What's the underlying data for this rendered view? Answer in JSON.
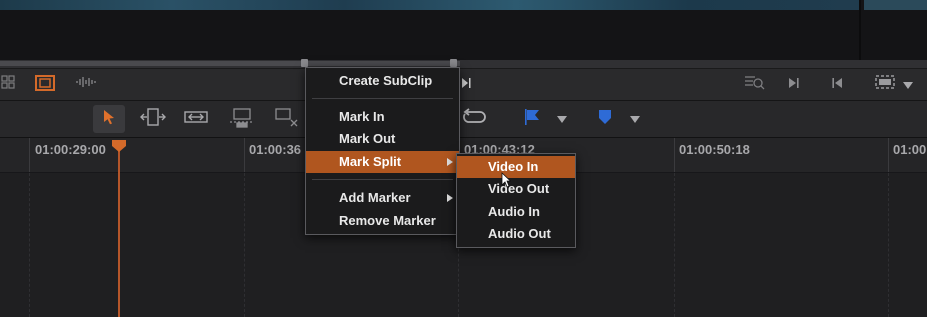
{
  "ruler": {
    "timecodes": [
      "01:00:29:00",
      "01:00:36",
      "01:00:43:12",
      "01:00:50:18",
      "01:00"
    ]
  },
  "context_menu": {
    "items": [
      {
        "label": "Create SubClip",
        "has_submenu": false
      },
      {
        "label": "Mark In",
        "has_submenu": false
      },
      {
        "label": "Mark Out",
        "has_submenu": false
      },
      {
        "label": "Mark Split",
        "has_submenu": true,
        "highlighted": true
      },
      {
        "label": "Add Marker",
        "has_submenu": true
      },
      {
        "label": "Remove Marker",
        "has_submenu": false
      }
    ]
  },
  "submenu": {
    "items": [
      {
        "label": "Video In",
        "highlighted": true
      },
      {
        "label": "Video Out"
      },
      {
        "label": "Audio In"
      },
      {
        "label": "Audio Out"
      }
    ]
  },
  "icons": {
    "viewer_toolbar": [
      "grid-icon",
      "filmstrip-icon",
      "audio-waveform-icon",
      "zoom-search-icon",
      "next-frame-icon",
      "prev-frame-icon",
      "fullscreen-icon"
    ],
    "edit_toolbar": [
      "selection-arrow-icon",
      "trim-icon",
      "dynamic-trim-icon",
      "razor-blade-icon",
      "insert-icon",
      "overwrite-icon",
      "loop-icon",
      "flag-icon",
      "marker-icon"
    ]
  },
  "colors": {
    "accent": "#b0561f",
    "playhead": "#b5562a",
    "flag": "#2e6bd6",
    "marker": "#2e6bd6"
  }
}
